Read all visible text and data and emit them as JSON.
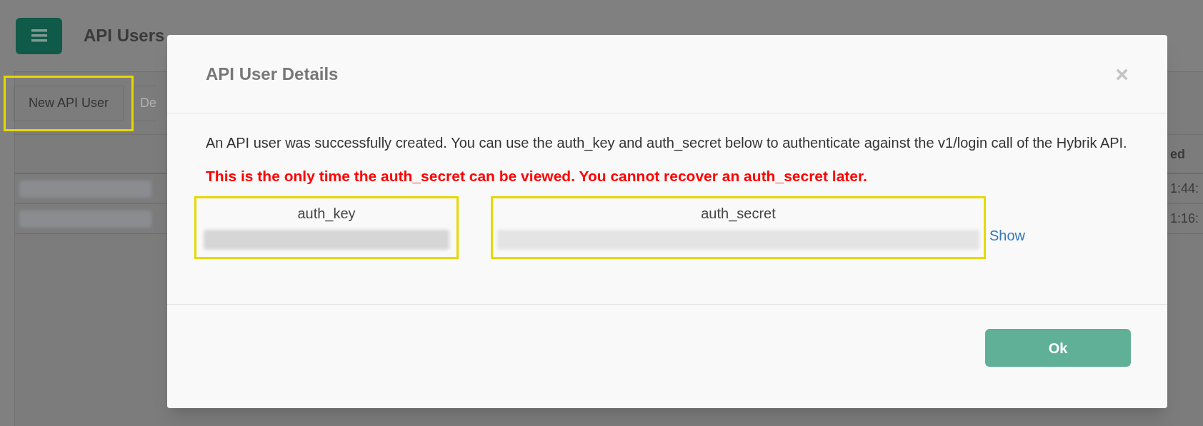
{
  "page": {
    "title": "API Users",
    "toolbar": [
      {
        "label": "New API User",
        "highlighted": true
      },
      {
        "label": "De",
        "highlighted": false
      }
    ],
    "table": {
      "column_header": "ed",
      "rows": [
        {
          "time": "1:44:"
        },
        {
          "time": "1:16:"
        }
      ]
    }
  },
  "dialog": {
    "title": "API User Details",
    "close": "×",
    "message": "An API user was successfully created. You can use the auth_key and auth_secret below to authenticate against the v1/login call of the Hybrik API.",
    "warning": "This is the only time the auth_secret can be viewed. You cannot recover an auth_secret later.",
    "fields": [
      {
        "label": "auth_key",
        "highlighted": true
      },
      {
        "label": "auth_secret",
        "highlighted": true,
        "action": "Show"
      }
    ],
    "button": "Ok"
  }
}
